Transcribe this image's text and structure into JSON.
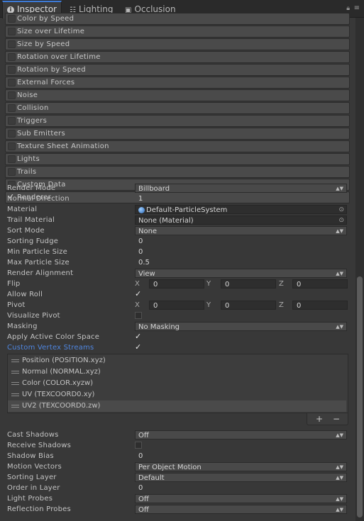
{
  "tabs": [
    {
      "label": "Inspector",
      "icon": "info-icon"
    },
    {
      "label": "Lighting",
      "icon": "lighting-sliders-icon"
    },
    {
      "label": "Occlusion",
      "icon": "occlusion-icon"
    }
  ],
  "modules": [
    {
      "label": "Color by Speed",
      "checked": false
    },
    {
      "label": "Size over Lifetime",
      "checked": false
    },
    {
      "label": "Size by Speed",
      "checked": false
    },
    {
      "label": "Rotation over Lifetime",
      "checked": false
    },
    {
      "label": "Rotation by Speed",
      "checked": false
    },
    {
      "label": "External Forces",
      "checked": false
    },
    {
      "label": "Noise",
      "checked": false
    },
    {
      "label": "Collision",
      "checked": false
    },
    {
      "label": "Triggers",
      "checked": false
    },
    {
      "label": "Sub Emitters",
      "checked": false
    },
    {
      "label": "Texture Sheet Animation",
      "checked": false
    },
    {
      "label": "Lights",
      "checked": false
    },
    {
      "label": "Trails",
      "checked": false
    },
    {
      "label": "Custom Data",
      "checked": false
    },
    {
      "label": "Renderer",
      "checked": true
    }
  ],
  "renderer": {
    "render_mode": {
      "label": "Render Mode",
      "value": "Billboard"
    },
    "normal_direction": {
      "label": "Normal Direction",
      "value": "1"
    },
    "material": {
      "label": "Material",
      "value": "Default-ParticleSystem"
    },
    "trail_material": {
      "label": "Trail Material",
      "value": "None (Material)"
    },
    "sort_mode": {
      "label": "Sort Mode",
      "value": "None"
    },
    "sorting_fudge": {
      "label": "Sorting Fudge",
      "value": "0"
    },
    "min_particle_size": {
      "label": "Min Particle Size",
      "value": "0"
    },
    "max_particle_size": {
      "label": "Max Particle Size",
      "value": "0.5"
    },
    "render_alignment": {
      "label": "Render Alignment",
      "value": "View"
    },
    "flip": {
      "label": "Flip",
      "x": "0",
      "y": "0",
      "z": "0"
    },
    "allow_roll": {
      "label": "Allow Roll",
      "checked": true
    },
    "pivot": {
      "label": "Pivot",
      "x": "0",
      "y": "0",
      "z": "0"
    },
    "visualize_pivot": {
      "label": "Visualize Pivot",
      "checked": false
    },
    "masking": {
      "label": "Masking",
      "value": "No Masking"
    },
    "apply_active_color_space": {
      "label": "Apply Active Color Space",
      "checked": true
    },
    "custom_vertex_streams": {
      "label": "Custom Vertex Streams",
      "checked": true
    },
    "streams": [
      "Position (POSITION.xyz)",
      "Normal (NORMAL.xyz)",
      "Color (COLOR.xyzw)",
      "UV (TEXCOORD0.xy)",
      "UV2 (TEXCOORD0.zw)"
    ],
    "cast_shadows": {
      "label": "Cast Shadows",
      "value": "Off"
    },
    "receive_shadows": {
      "label": "Receive Shadows",
      "checked": false
    },
    "shadow_bias": {
      "label": "Shadow Bias",
      "value": "0"
    },
    "motion_vectors": {
      "label": "Motion Vectors",
      "value": "Per Object Motion"
    },
    "sorting_layer": {
      "label": "Sorting Layer",
      "value": "Default"
    },
    "order_in_layer": {
      "label": "Order in Layer",
      "value": "0"
    },
    "light_probes": {
      "label": "Light Probes",
      "value": "Off"
    },
    "reflection_probes": {
      "label": "Reflection Probes",
      "value": "Off"
    }
  },
  "axis_labels": {
    "x": "X",
    "y": "Y",
    "z": "Z"
  },
  "list_buttons": {
    "add": "+",
    "remove": "−"
  },
  "glyphs": {
    "check": "✓",
    "popup_arrow": "▲▼",
    "object_picker": "⊙"
  },
  "colors": {
    "accent": "#3d7bd8",
    "link": "#4f86e0",
    "background": "#383838"
  }
}
